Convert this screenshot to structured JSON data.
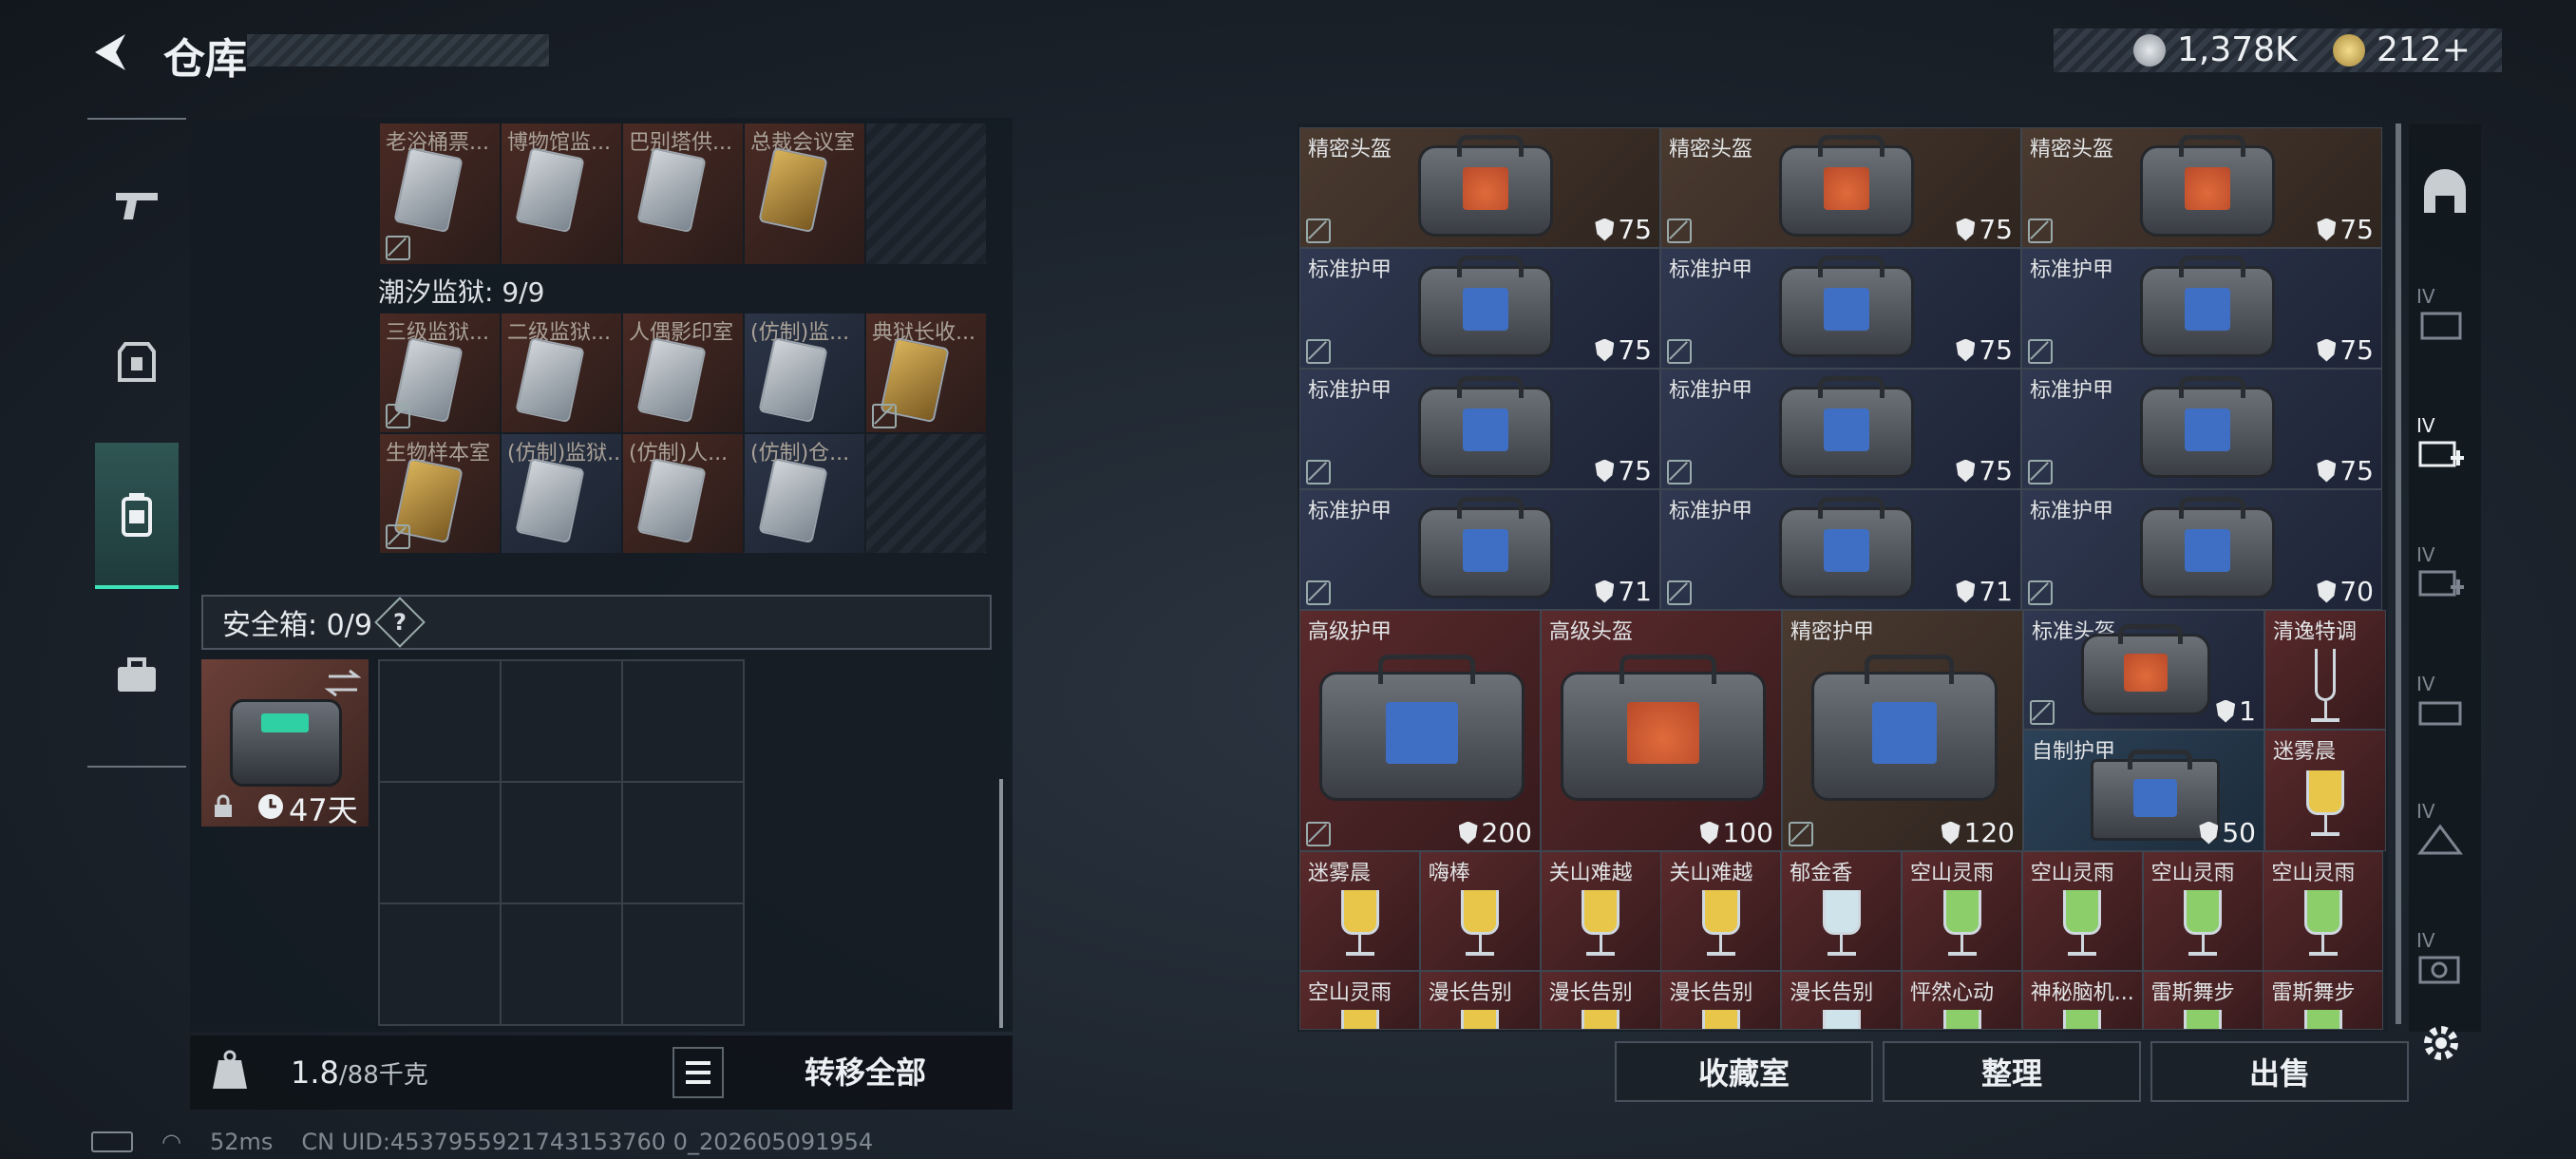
{
  "header": {
    "title": "仓库",
    "currency_1": "1,378K",
    "currency_2": "212+"
  },
  "left_grid": {
    "top_row_labels": [
      "老浴桶票...",
      "博物馆监...",
      "巴别塔供...",
      "总裁会议室"
    ],
    "prison_title": "潮汐监狱: 9/9",
    "prison_row1": [
      "三级监狱...",
      "二级监狱...",
      "人偶影印室",
      "(仿制)监...",
      "典狱长收..."
    ],
    "prison_row2": [
      "生物样本室",
      "(仿制)监狱...",
      "(仿制)人...",
      "(仿制)仓..."
    ]
  },
  "safe": {
    "label": "安全箱: 0/9",
    "help": "?",
    "timer": "47天"
  },
  "footer_left": {
    "weight": "1.8",
    "weight_cap": "/88千克",
    "transfer_all": "转移全部"
  },
  "right_items": {
    "row1": [
      {
        "label": "精密头盔",
        "dur": "75"
      },
      {
        "label": "精密头盔",
        "dur": "75"
      },
      {
        "label": "精密头盔",
        "dur": "75"
      }
    ],
    "row2": [
      {
        "label": "标准护甲",
        "dur": "75"
      },
      {
        "label": "标准护甲",
        "dur": "75"
      },
      {
        "label": "标准护甲",
        "dur": "75"
      }
    ],
    "row3": [
      {
        "label": "标准护甲",
        "dur": "75"
      },
      {
        "label": "标准护甲",
        "dur": "75"
      },
      {
        "label": "标准护甲",
        "dur": "75"
      }
    ],
    "row4": [
      {
        "label": "标准护甲",
        "dur": "71"
      },
      {
        "label": "标准护甲",
        "dur": "71"
      },
      {
        "label": "标准护甲",
        "dur": "70"
      }
    ],
    "big": [
      {
        "label": "高级护甲",
        "dur": "200"
      },
      {
        "label": "高级头盔",
        "dur": "100"
      },
      {
        "label": "精密护甲",
        "dur": "120"
      }
    ],
    "small_right": [
      {
        "label": "标准头盔",
        "dur": "1"
      },
      {
        "label": "自制护甲",
        "dur": "50"
      }
    ],
    "side_drinks": [
      "清逸特调",
      "迷雾晨"
    ],
    "drink_row1": [
      "迷雾晨",
      "嗨棒",
      "关山难越",
      "关山难越",
      "郁金香",
      "空山灵雨",
      "空山灵雨",
      "空山灵雨",
      "空山灵雨"
    ],
    "drink_row2": [
      "空山灵雨",
      "漫长告别",
      "漫长告别",
      "漫长告别",
      "漫长告别",
      "怦然心动",
      "神秘脑机...",
      "雷斯舞步",
      "雷斯舞步"
    ]
  },
  "footer_right": {
    "collection": "收藏室",
    "sort": "整理",
    "sell": "出售"
  },
  "right_nav_labels": [
    "IV",
    "IV",
    "IV",
    "IV",
    "IV",
    "IV"
  ],
  "status": {
    "ping": "52ms",
    "uid": "CN UID:4537955921743153760 0_202605091954"
  },
  "colors": {
    "accent": "#3ee0b8",
    "panel": "#1b2129"
  }
}
